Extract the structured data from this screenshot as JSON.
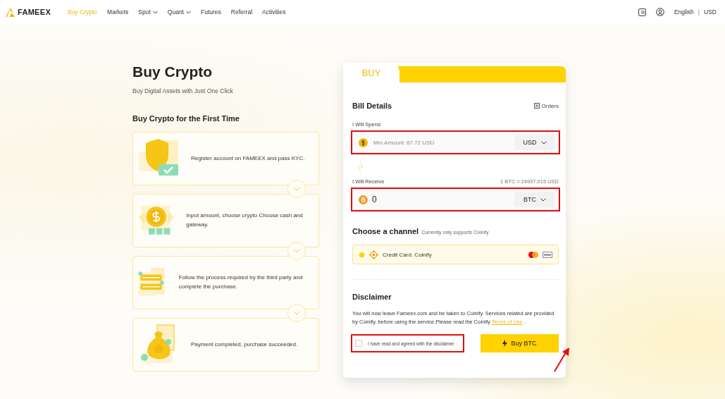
{
  "nav": {
    "logo": "FAMEEX",
    "items": [
      {
        "label": "Buy Crypto",
        "selected": true,
        "dropdown": false
      },
      {
        "label": "Markets",
        "selected": false,
        "dropdown": false
      },
      {
        "label": "Spot",
        "selected": false,
        "dropdown": true
      },
      {
        "label": "Quant",
        "selected": false,
        "dropdown": true
      },
      {
        "label": "Futures",
        "selected": false,
        "dropdown": false
      },
      {
        "label": "Referral",
        "selected": false,
        "dropdown": false
      },
      {
        "label": "Activities",
        "selected": false,
        "dropdown": false
      }
    ],
    "language": "English",
    "separator": "|",
    "currency": "USD"
  },
  "intro": {
    "title": "Buy Crypto",
    "subtitle": "Buy Digital Assets with Just One Click",
    "steps_title": "Buy Crypto for the First Time",
    "steps": [
      {
        "kind": "kyc",
        "text": "Register account on FAMEEX and pass KYC."
      },
      {
        "kind": "amount",
        "text": "Input amount, choose crypto Choose cash and gateway."
      },
      {
        "kind": "process",
        "text": "Follow the process required by the third party and complete the purchase."
      },
      {
        "kind": "payment",
        "text": "Payment completed, purchase succeeded."
      }
    ]
  },
  "card": {
    "tab": "BUY",
    "bill_title": "Bill Details",
    "orders": "Orders",
    "spend": {
      "label": "I Will Spend",
      "placeholder": "Min.Amount: 67.72 USD",
      "currency": "USD",
      "highlighted": true
    },
    "receive": {
      "label": "I Will Receive",
      "rate": "1 BTC ≈ 24997.015 USD",
      "value": "0",
      "currency": "BTC",
      "highlighted": true
    },
    "channel": {
      "title": "Choose a channel",
      "note": "Currently only supports Coinify",
      "option": "Credit Card. Coinify",
      "selected": true
    },
    "disclaimer": {
      "title": "Disclaimer",
      "text": "You will now leave Fameex.com and be taken to Coinify. Services related are provided by Coinify,  before using the service,Please read the Coinify",
      "link": "Terms of Use",
      "end": " .",
      "agree": {
        "label": "I have read and agreed with the disclaimer",
        "checked": false,
        "highlighted": true
      }
    },
    "buy_button": {
      "label": "Buy BTC",
      "pointer_arrow": true
    }
  }
}
